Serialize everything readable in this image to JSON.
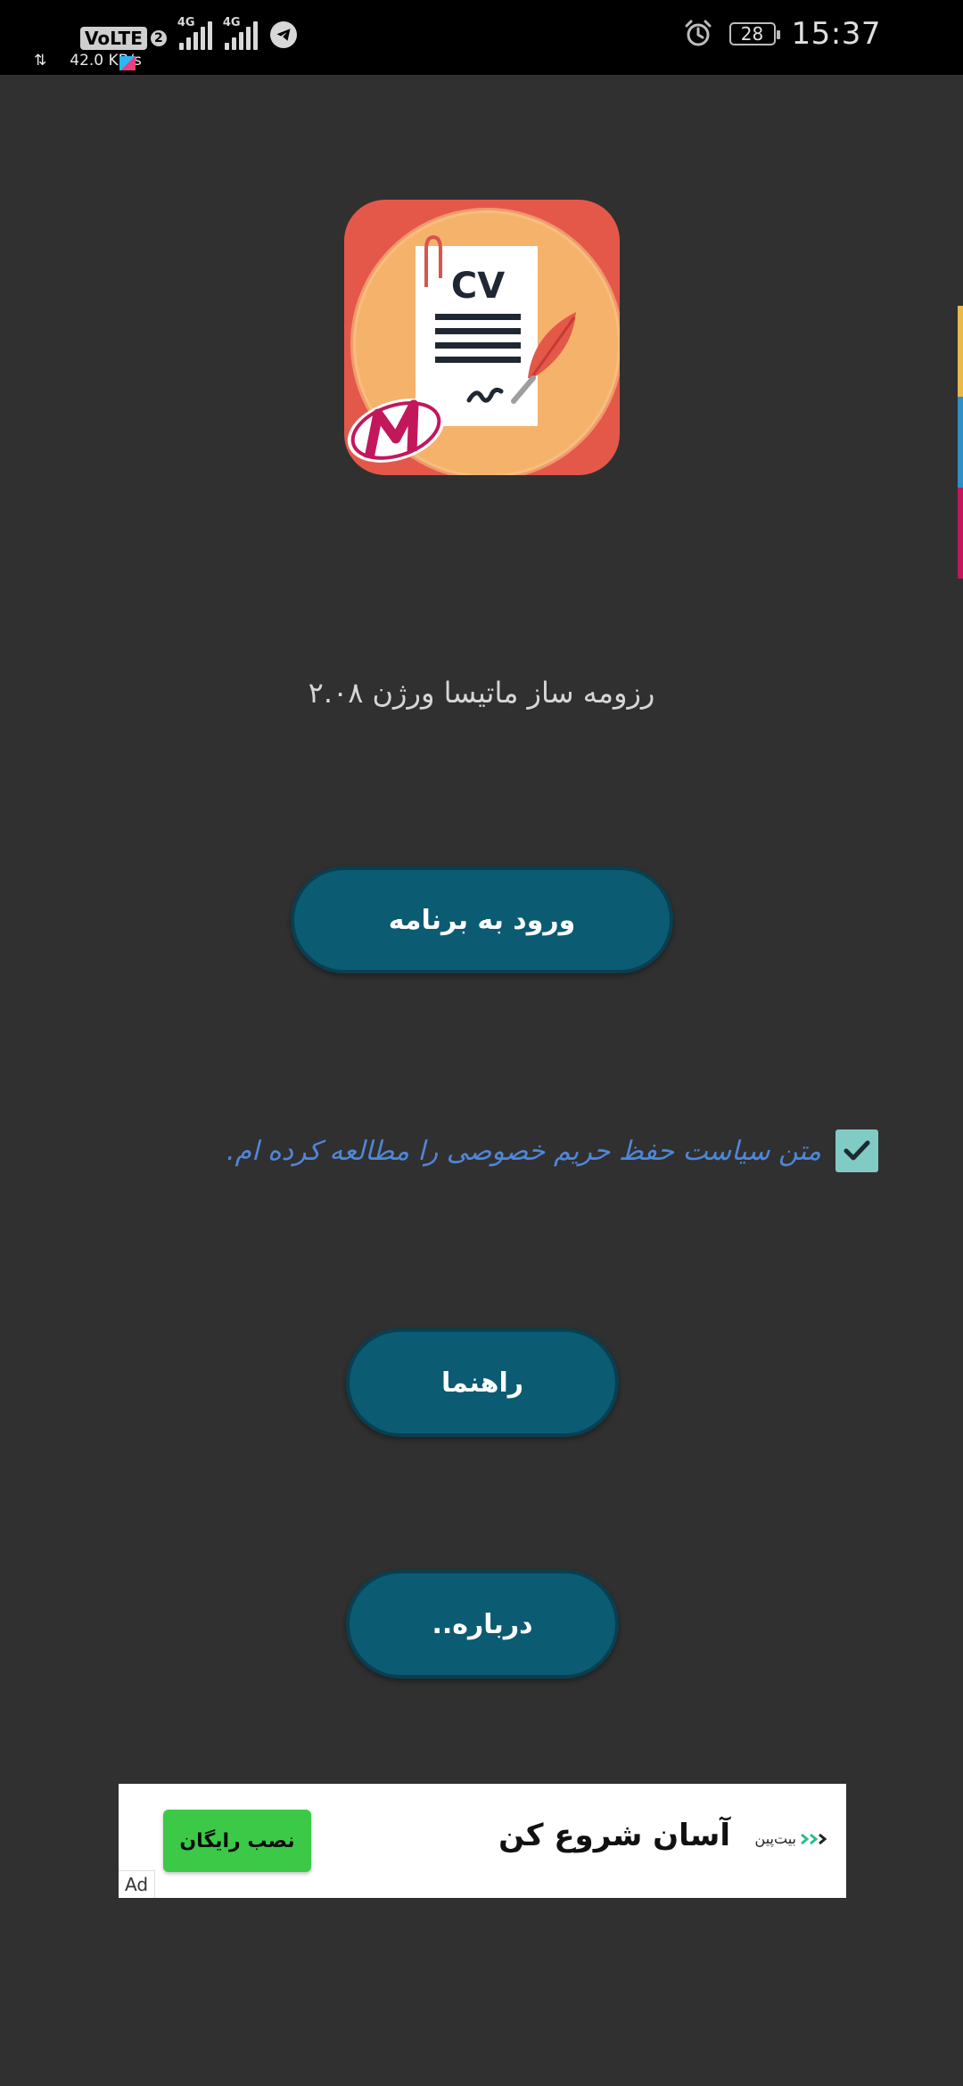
{
  "status_bar": {
    "volte": "VoLTE",
    "sim_number": "2",
    "network_1": "4G",
    "network_2": "4G",
    "speed": "42.0 KB/s",
    "battery": "28",
    "time": "15:37"
  },
  "app": {
    "version_text": "رزومه ساز ماتیسا ورژن ۲.۰۸",
    "enter_button": "ورود به برنامه",
    "privacy_text": "متن سیاست حفظ حریم خصوصی را مطالعه کرده ام.",
    "privacy_checked": true,
    "guide_button": "راهنما",
    "about_button": "درباره.."
  },
  "ad": {
    "install_button": "نصب رایگان",
    "headline": "آسان شروع کن",
    "brand": "بیت‌پین",
    "label": "Ad"
  },
  "logo": {
    "text": "CV"
  },
  "colors": {
    "background": "#303030",
    "button": "#0b5b72",
    "privacy_text": "#4f87d8",
    "checkbox": "#80cbc4",
    "ad_install": "#3cc947"
  }
}
